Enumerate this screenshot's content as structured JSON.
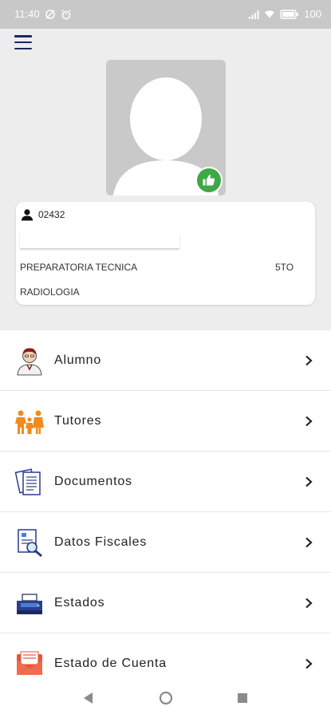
{
  "status_bar": {
    "time": "11:40",
    "battery": "100"
  },
  "student_card": {
    "id": "02432",
    "program": "PREPARATORIA TECNICA",
    "grade": "5TO",
    "specialty": "RADIOLOGIA"
  },
  "menu": {
    "items": [
      {
        "label": "Alumno",
        "icon": "student-icon"
      },
      {
        "label": "Tutores",
        "icon": "family-icon"
      },
      {
        "label": "Documentos",
        "icon": "documents-icon"
      },
      {
        "label": "Datos Fiscales",
        "icon": "fiscal-data-icon"
      },
      {
        "label": "Estados",
        "icon": "printer-icon"
      },
      {
        "label": "Estado de Cuenta",
        "icon": "envelope-icon"
      }
    ]
  },
  "colors": {
    "accent_green": "#3ea845",
    "menu_icon_navy": "#1b2a5c",
    "family_orange": "#f28a1e",
    "envelope_red": "#e8543a"
  }
}
